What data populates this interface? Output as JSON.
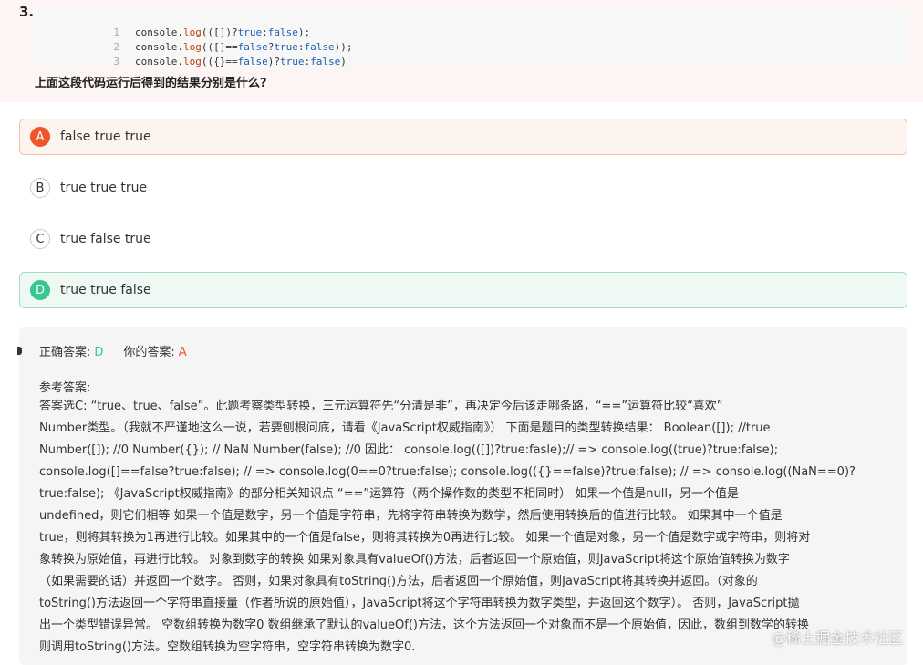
{
  "question": {
    "number": "3.",
    "code_lines": [
      {
        "ln": "1",
        "code": "console.log(([])?true:false);"
      },
      {
        "ln": "2",
        "code": "console.log(([]==false?true:false));"
      },
      {
        "ln": "3",
        "code": "console.log(({}==false)?true:false)"
      }
    ],
    "prompt": "上面这段代码运行后得到的结果分别是什么?"
  },
  "options": [
    {
      "letter": "A",
      "text": "false true true",
      "state": "wrong"
    },
    {
      "letter": "B",
      "text": "true true true",
      "state": "normal"
    },
    {
      "letter": "C",
      "text": "true false true",
      "state": "normal"
    },
    {
      "letter": "D",
      "text": "true true false",
      "state": "correct"
    }
  ],
  "answer": {
    "correct_label": "正确答案:",
    "correct_value": "D",
    "yours_label": "你的答案:",
    "yours_value": "A",
    "colors": {
      "correct": "#37c78f",
      "wrong": "#f0542a"
    }
  },
  "reference": {
    "title": "参考答案:",
    "lines": [
      "答案选C: “true、true、false”。此题考察类型转换，三元运算符先“分清是非”，再决定今后该走哪条路，“==”运算符比较“喜欢”",
      "Number类型。（我就不严谨地这么一说，若要刨根问底，请看《JavaScript权威指南》） 下面是题目的类型转换结果： Boolean([]); //true",
      "Number([]); //0 Number({}); // NaN Number(false); //0 因此： console.log(([])?true:fasle);// => console.log((true)?true:false);",
      "console.log([]==false?true:false); // => console.log(0==0?true:false); console.log(({}==false)?true:false); // => console.log((NaN==0)?",
      "true:false); 《JavaScript权威指南》的部分相关知识点 “==”运算符（两个操作数的类型不相同时） 如果一个值是null，另一个值是",
      "undefined，则它们相等 如果一个值是数字，另一个值是字符串，先将字符串转换为数学，然后使用转换后的值进行比较。 如果其中一个值是",
      "true，则将其转换为1再进行比较。如果其中的一个值是false，则将其转换为0再进行比较。 如果一个值是对象，另一个值是数字或字符串，则将对",
      "象转换为原始值，再进行比较。 对象到数字的转换 如果对象具有valueOf()方法，后者返回一个原始值，则JavaScript将这个原始值转换为数字",
      "（如果需要的话）并返回一个数字。 否则，如果对象具有toString()方法，后者返回一个原始值，则JavaScript将其转换并返回。（对象的",
      "toString()方法返回一个字符串直接量（作者所说的原始值），JavaScript将这个字符串转换为数字类型，并返回这个数字）。 否则，JavaScript抛",
      "出一个类型错误异常。 空数组转换为数字0 数组继承了默认的valueOf()方法，这个方法返回一个对象而不是一个原始值，因此，数组到数学的转换",
      "则调用toString()方法。空数组转换为空字符串，空字符串转换为数字0."
    ]
  },
  "watermark": "@稀土掘金技术社区"
}
